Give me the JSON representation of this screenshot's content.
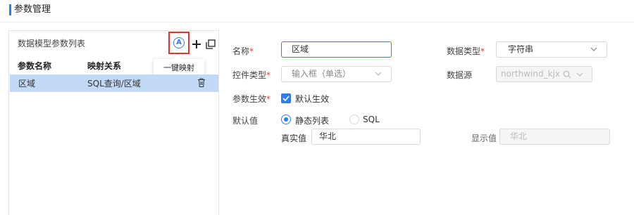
{
  "page": {
    "title": "参数管理"
  },
  "left_panel": {
    "title": "数据模型参数列表",
    "tooltip": "一键映射",
    "columns": [
      "参数名称",
      "映射关系"
    ],
    "rows": [
      {
        "name": "区域",
        "mapping": "SQL查询/区域"
      }
    ]
  },
  "form": {
    "name_label": "名称",
    "name_value": "区域",
    "data_type_label": "数据类型",
    "data_type_value": "字符串",
    "control_type_label": "控件类型",
    "control_type_value": "输入框（单选）",
    "data_source_label": "数据源",
    "data_source_value": "northwind_kjx",
    "param_effect_label": "参数生效",
    "default_effect_label": "默认生效",
    "default_value_label": "默认值",
    "radio_static": "静态列表",
    "radio_sql": "SQL",
    "real_value_label": "真实值",
    "real_value": "华北",
    "display_value_label": "显示值",
    "display_value": "华北",
    "required_mark": "*"
  },
  "colors": {
    "accent": "#2f7df6",
    "selected_row": "#c2daf7",
    "highlight_box": "#e8322f",
    "required": "#e53935"
  }
}
